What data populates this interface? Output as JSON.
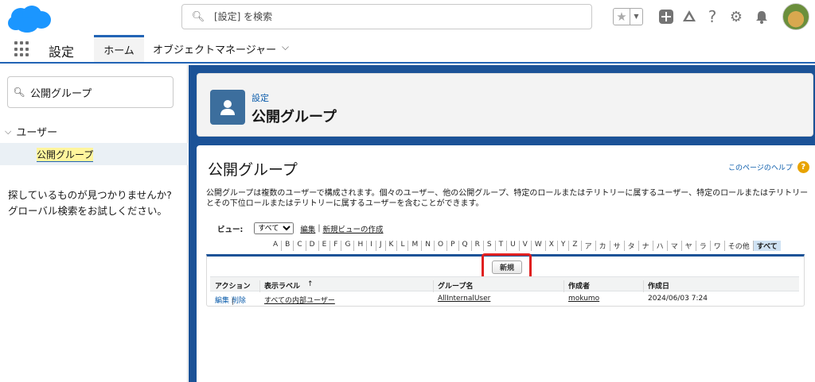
{
  "header": {
    "search_placeholder": "[設定] を検索"
  },
  "nav": {
    "app_name": "設定",
    "tabs": [
      {
        "label": "ホーム"
      },
      {
        "label": "オブジェクトマネージャー"
      }
    ]
  },
  "sidebar": {
    "quickfind_value": "公開グループ",
    "group_label": "ユーザー",
    "item_label": "公開グループ",
    "not_found_line1": "探しているものが見つかりませんか?",
    "not_found_line2": "グローバル検索をお試しください。"
  },
  "page_header": {
    "breadcrumb": "設定",
    "title": "公開グループ"
  },
  "content": {
    "title": "公開グループ",
    "help_link": "このページのヘルプ",
    "description": "公開グループは複数のユーザーで構成されます。個々のユーザー、他の公開グループ、特定のロールまたはテリトリーに属するユーザー、特定のロールまたはテリトリーとその下位ロールまたはテリトリーに属するユーザーを含むことができます。",
    "view_label": "ビュー:",
    "view_selected": "すべて",
    "edit_link": "編集",
    "new_view_link": "新規ビューの作成",
    "alphabet": [
      "A",
      "B",
      "C",
      "D",
      "E",
      "F",
      "G",
      "H",
      "I",
      "J",
      "K",
      "L",
      "M",
      "N",
      "O",
      "P",
      "Q",
      "R",
      "S",
      "T",
      "U",
      "V",
      "W",
      "X",
      "Y",
      "Z",
      "ア",
      "カ",
      "サ",
      "タ",
      "ナ",
      "ハ",
      "マ",
      "ヤ",
      "ラ",
      "ワ",
      "その他",
      "すべて"
    ],
    "new_button": "新規",
    "columns": {
      "action": "アクション",
      "label": "表示ラベル",
      "label_sort": "↑",
      "group_name": "グループ名",
      "created_by": "作成者",
      "created_date": "作成日"
    },
    "rows": [
      {
        "edit": "編集",
        "delete": "削除",
        "label": "すべての内部ユーザー",
        "group_name": "AllInternalUser",
        "created_by": "mokumo",
        "created_date": "2024/06/03 7:24"
      }
    ]
  },
  "icons": {
    "logo": "salesforce-cloud-logo",
    "brand_color": "#1b96ff"
  }
}
